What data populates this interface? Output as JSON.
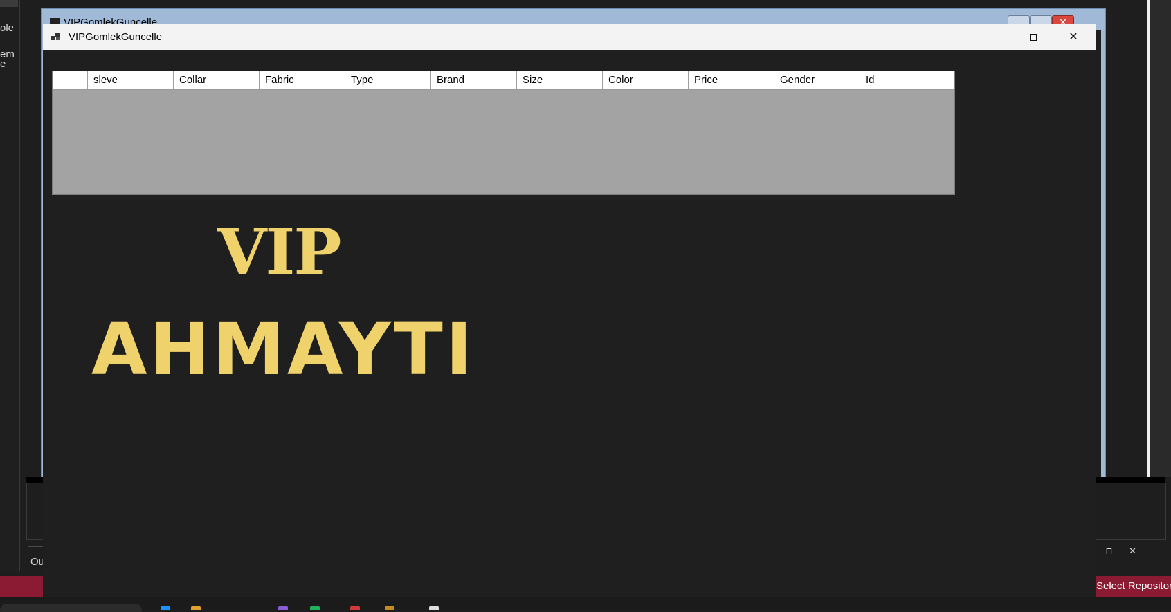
{
  "background_ide": {
    "left_fragments": [
      "ole",
      "em",
      "e"
    ],
    "output_tab_label": "Ou",
    "panel_controls": "▾ ⊓ ✕",
    "status_right_text": "Select Repositor"
  },
  "back_window": {
    "title": "VIPGomlekGuncelle",
    "close_glyph": "✕"
  },
  "window": {
    "title": "VIPGomlekGuncelle",
    "close_glyph": "✕"
  },
  "grid": {
    "columns": [
      "sleve",
      "Collar",
      "Fabric",
      "Type",
      "Brand",
      "Size",
      "Color",
      "Price",
      "Gender",
      "Id"
    ],
    "rows": []
  },
  "logo": {
    "line1": "VIP",
    "line2": "AHMAYTI",
    "color": "#f0d26c"
  },
  "colors": {
    "status_bar": "#8a1b32",
    "window_bg": "#1f1f1f",
    "grid_body": "#a3a3a3"
  }
}
